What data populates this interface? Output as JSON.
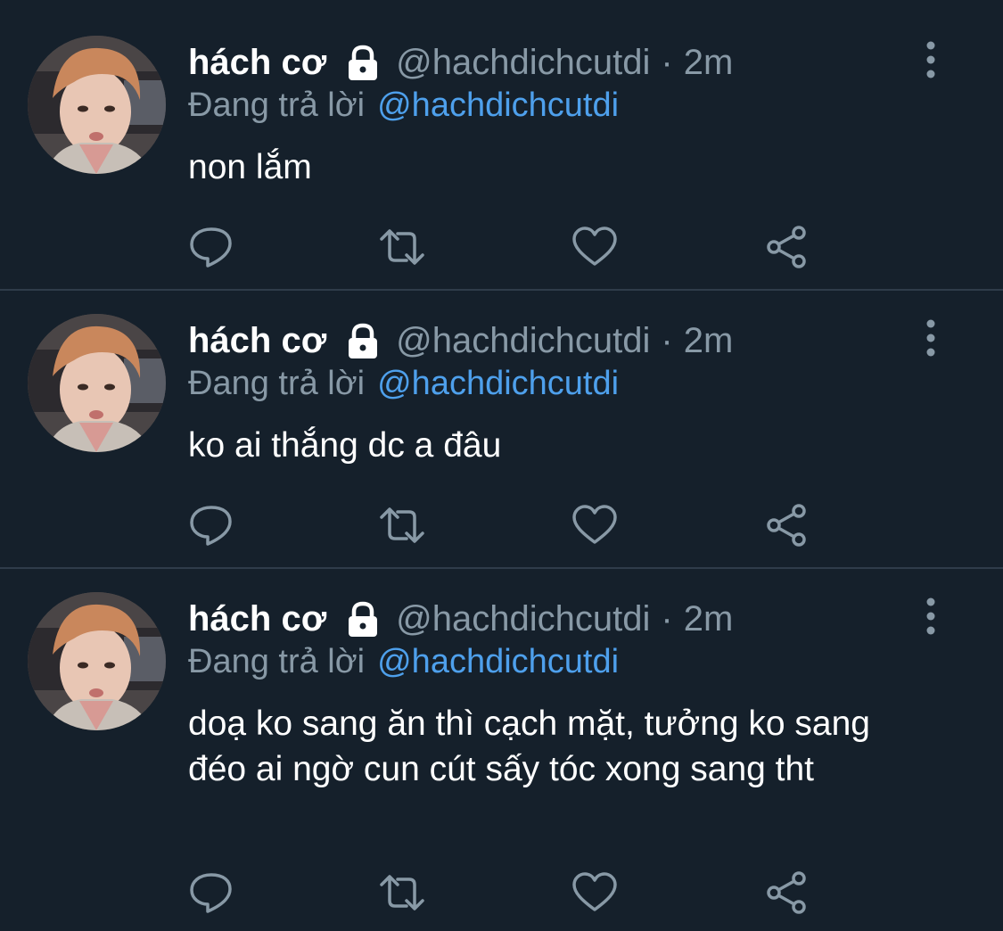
{
  "colors": {
    "background": "#15202b",
    "divider": "#2f3c4a",
    "name_text": "#ffffff",
    "secondary_text": "#8899a6",
    "link_blue": "#4ea0ec",
    "icon_gray": "#8899a6"
  },
  "icons": {
    "lock": "lock-icon",
    "more": "more-vertical-icon",
    "reply": "reply-icon",
    "retweet": "retweet-icon",
    "like": "heart-icon",
    "share": "share-icon"
  },
  "tweets": [
    {
      "display_name": "hách cơ",
      "handle": "@hachdichcutdi",
      "separator": "·",
      "time": "2m",
      "reply_prefix": "Đang trả lời",
      "reply_target": "@hachdichcutdi",
      "text": "non lắm"
    },
    {
      "display_name": "hách cơ",
      "handle": "@hachdichcutdi",
      "separator": "·",
      "time": "2m",
      "reply_prefix": "Đang trả lời",
      "reply_target": "@hachdichcutdi",
      "text": "ko ai thắng dc a đâu"
    },
    {
      "display_name": "hách cơ",
      "handle": "@hachdichcutdi",
      "separator": "·",
      "time": "2m",
      "reply_prefix": "Đang trả lời",
      "reply_target": "@hachdichcutdi",
      "text": "doạ ko sang ăn thì cạch mặt, tưởng ko sang đéo ai ngờ cun cút sấy tóc xong sang tht"
    }
  ]
}
